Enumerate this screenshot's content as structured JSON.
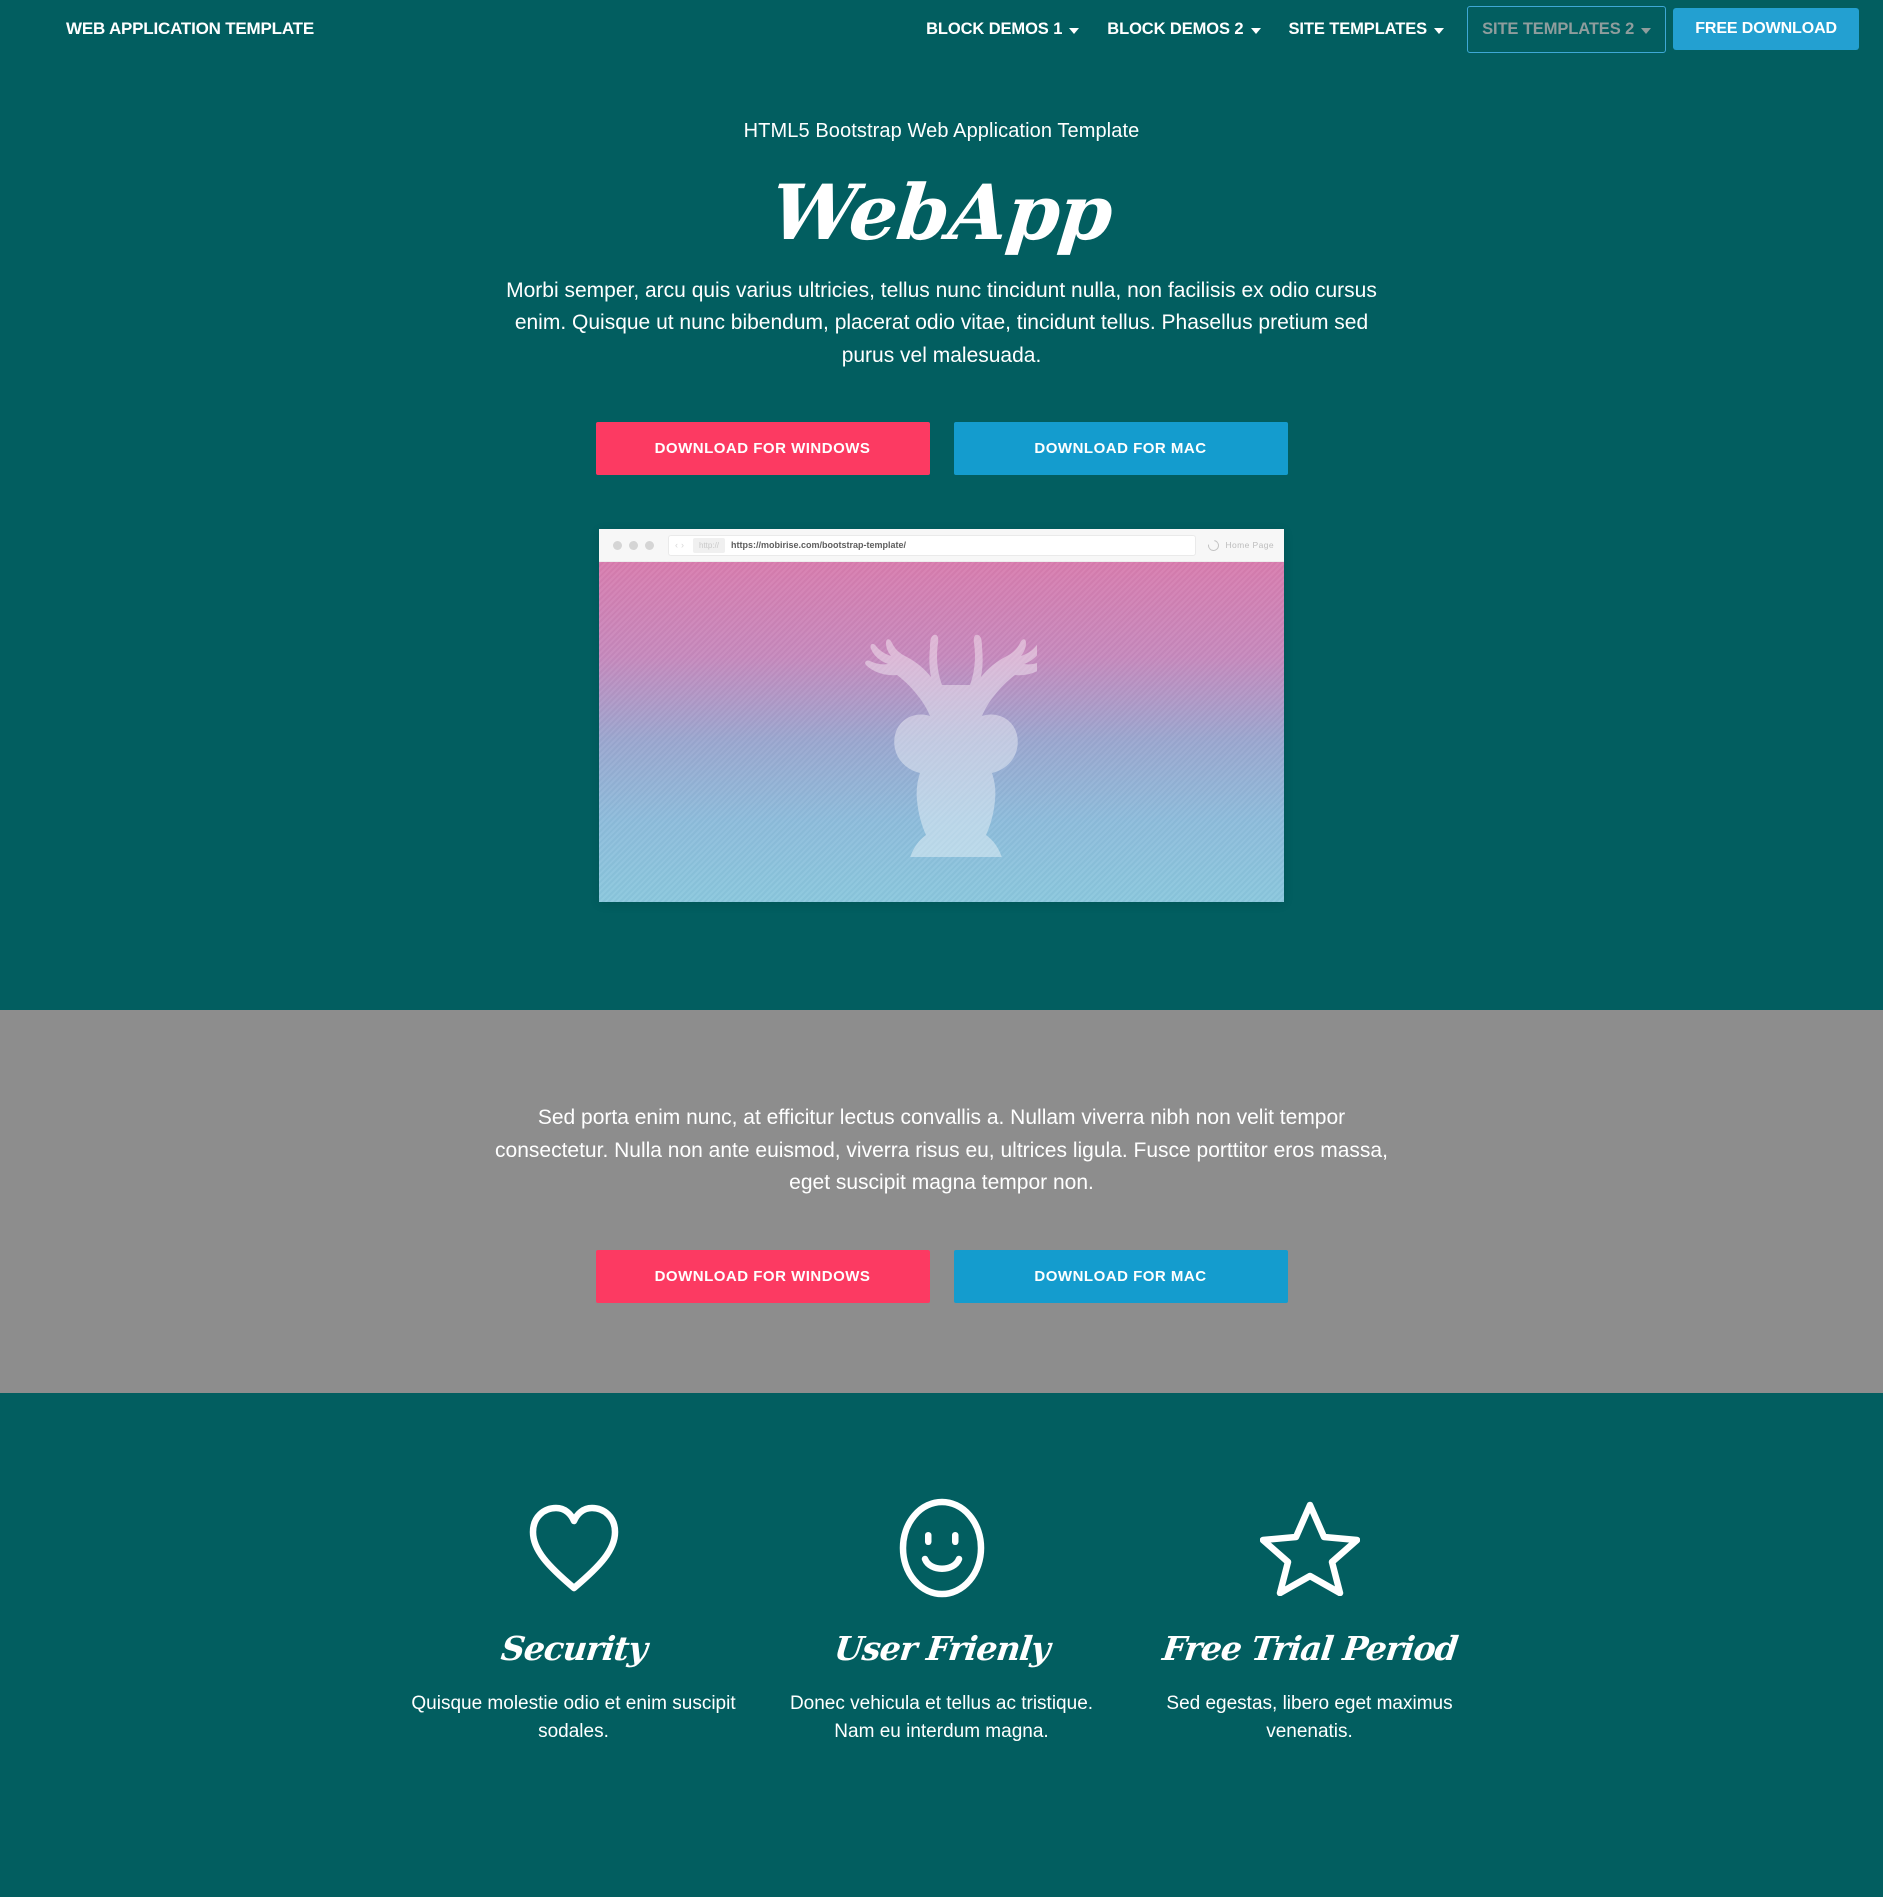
{
  "navbar": {
    "brand": "WEB APPLICATION TEMPLATE",
    "links": [
      {
        "label": "BLOCK DEMOS 1",
        "caret": true,
        "focused": false
      },
      {
        "label": "BLOCK DEMOS 2",
        "caret": true,
        "focused": false
      },
      {
        "label": "SITE TEMPLATES",
        "caret": true,
        "focused": false
      },
      {
        "label": "SITE TEMPLATES 2",
        "caret": true,
        "focused": true
      }
    ],
    "cta_label": "FREE DOWNLOAD"
  },
  "hero": {
    "kicker": "HTML5 Bootstrap Web Application Template",
    "title": "WebApp",
    "paragraph": "Morbi semper, arcu quis varius ultricies, tellus nunc tincidunt nulla, non facilisis ex odio cursus enim. Quisque ut nunc bibendum, placerat odio vitae, tincidunt tellus. Phasellus pretium sed purus vel malesuada.",
    "btn_windows": "DOWNLOAD FOR WINDOWS",
    "btn_mac": "DOWNLOAD FOR MAC"
  },
  "mockup": {
    "http_chip": "http://",
    "url": "https://mobirise.com/bootstrap-template/",
    "tab_label": "Home Page",
    "image_subject": "deer-silhouette"
  },
  "gray_section": {
    "paragraph": "Sed porta enim nunc, at efficitur lectus convallis a. Nullam viverra nibh non velit tempor consectetur. Nulla non ante euismod, viverra risus eu, ultrices ligula. Fusce porttitor eros massa, eget suscipit magna tempor non.",
    "btn_windows": "DOWNLOAD FOR WINDOWS",
    "btn_mac": "DOWNLOAD FOR MAC"
  },
  "features": [
    {
      "icon": "heart-icon",
      "title": "Security",
      "desc": "Quisque molestie odio et enim suscipit sodales."
    },
    {
      "icon": "smiley-face-icon",
      "title": "User Frienly",
      "desc": "Donec vehicula et tellus ac tristique. Nam eu interdum magna."
    },
    {
      "icon": "star-icon",
      "title": "Free Trial Period",
      "desc": "Sed egestas, libero eget maximus venenatis."
    }
  ],
  "colors": {
    "teal": "#025e60",
    "gray": "#8d8d8d",
    "pink": "#fc3a62",
    "blue": "#149cce",
    "nav_blue": "#23a0d1",
    "focus_ring": "#3ea8d6",
    "gradient_top": "#d87cae",
    "gradient_bottom": "#8ac7dd"
  }
}
